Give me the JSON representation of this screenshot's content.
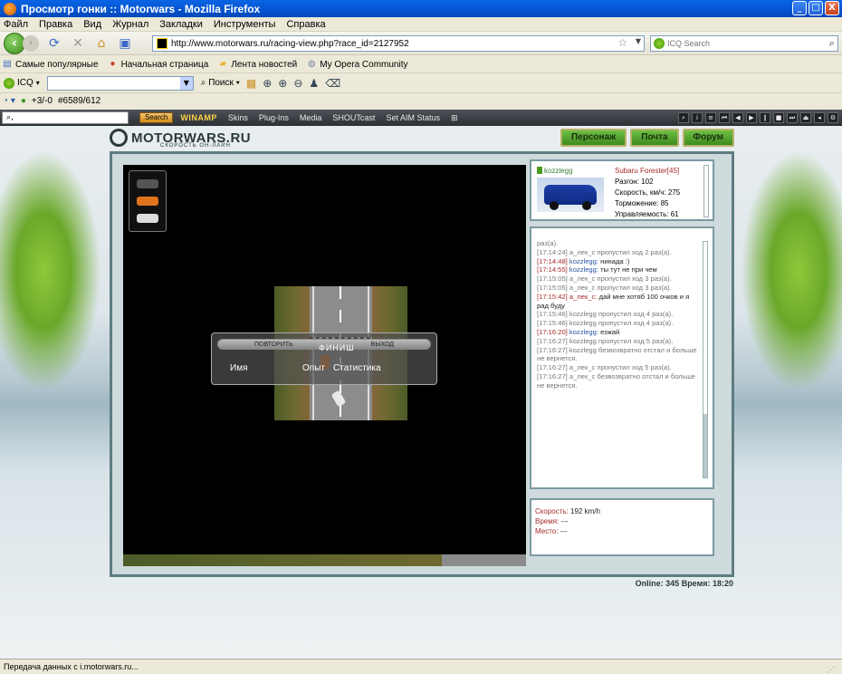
{
  "window": {
    "title": "Просмотр гонки :: Motorwars - Mozilla Firefox",
    "min": "_",
    "max": "□",
    "close": "X"
  },
  "menu": [
    "Файл",
    "Правка",
    "Вид",
    "Журнал",
    "Закладки",
    "Инструменты",
    "Справка"
  ],
  "nav": {
    "url": "http://www.motorwars.ru/racing-view.php?race_id=2127952",
    "icq_search_placeholder": "ICQ Search"
  },
  "bookmarks": [
    "Самые популярные",
    "Начальная страница",
    "Лента новостей",
    "My Opera Community"
  ],
  "icqbar": {
    "label": "ICQ",
    "search_btn": "Поиск"
  },
  "statusbar_top": {
    "score": "+3/-0",
    "id": "#6589/612"
  },
  "winamp": {
    "search_btn": "Search",
    "logo": "WINAMP",
    "items": [
      "Skins",
      "Plug-Ins",
      "Media",
      "SHOUTcast",
      "Set AIM Status"
    ]
  },
  "site": {
    "brand": "MOTORWARS.RU",
    "slogan": "СКОРОСТЬ ОН-ЛАЙН",
    "nav": [
      "Персонаж",
      "Почта",
      "Форум"
    ]
  },
  "dialog": {
    "tab_left": "ПОВТОРИТЬ",
    "tab_right": "ВЫХОД",
    "finish": "ФИНИШ",
    "col_name": "Имя",
    "col_exp": "Опыт",
    "col_stats": "Статистика"
  },
  "car": {
    "user": "kozzlegg",
    "model": "Subaru Forester[45]",
    "stats": [
      "Разгон: 102",
      "Скорость, км/ч: 275",
      "Торможение: 85",
      "Управляемость: 61"
    ]
  },
  "chat": [
    {
      "ts": "",
      "nick": "",
      "text": "раз(а).",
      "kind": "sys"
    },
    {
      "ts": "[17:14:24]",
      "nick": "",
      "text": "а_лек_с пропустил ход 2 раз(а).",
      "kind": "sys"
    },
    {
      "ts": "[17:14:48]",
      "nick": "kozzlegg:",
      "text": "нинада :)",
      "kind": "msg",
      "red": true
    },
    {
      "ts": "[17:14:55]",
      "nick": "kozzlegg:",
      "text": "ты тут не при чем",
      "kind": "msg",
      "red": true
    },
    {
      "ts": "[17:15:05]",
      "nick": "",
      "text": "а_лек_с пропустил ход 3 раз(а).",
      "kind": "sys"
    },
    {
      "ts": "[17:15:05]",
      "nick": "",
      "text": "а_лек_с пропустил ход 3 раз(а).",
      "kind": "sys"
    },
    {
      "ts": "[17:15:42]",
      "nick": "а_лек_с:",
      "text": "дай мне хотяб 100 очков и я рад буду",
      "kind": "msg",
      "red": true,
      "redname": true
    },
    {
      "ts": "[17:15:46]",
      "nick": "",
      "text": "kozzlegg пропустил ход 4 раз(а).",
      "kind": "sys"
    },
    {
      "ts": "[17:15:46]",
      "nick": "",
      "text": "kozzlegg пропустил ход 4 раз(а).",
      "kind": "sys"
    },
    {
      "ts": "[17:16:20]",
      "nick": "kozzlegg:",
      "text": "езжай",
      "kind": "msg",
      "red": true
    },
    {
      "ts": "[17:16:27]",
      "nick": "",
      "text": "kozzlegg пропустил ход 5 раз(а).",
      "kind": "sys"
    },
    {
      "ts": "[17:16:27]",
      "nick": "",
      "text": "kozzlegg безвозвратно отстал и больше не вернется.",
      "kind": "sys"
    },
    {
      "ts": "[17:16:27]",
      "nick": "",
      "text": "а_лек_с пропустил ход 5 раз(а).",
      "kind": "sys"
    },
    {
      "ts": "[17:16:27]",
      "nick": "",
      "text": "а_лек_с безвозвратно отстал и больше не вернется.",
      "kind": "sys"
    }
  ],
  "info": {
    "speed_k": "Скорость:",
    "speed_v": "192 km/h",
    "time_k": "Время:",
    "time_v": "---",
    "place_k": "Место:",
    "place_v": "---"
  },
  "online": "Online: 345  Время: 18:20",
  "status": "Передача данных с i.motorwars.ru..."
}
